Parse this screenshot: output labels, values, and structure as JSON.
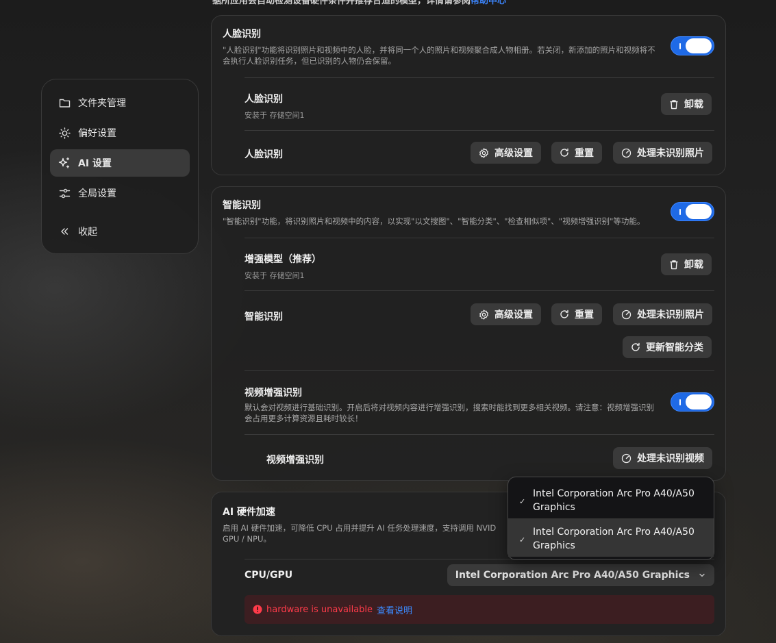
{
  "top_fragment": {
    "text": "据所应用会自动检测设备硬件条件并推荐合适的模型，详情请参阅",
    "link": "帮助中心"
  },
  "sidebar": {
    "items": [
      {
        "label": "文件夹管理",
        "icon": "folder-icon"
      },
      {
        "label": "偏好设置",
        "icon": "sun-icon"
      },
      {
        "label": "AI 设置",
        "icon": "sparkle-icon",
        "active": true
      },
      {
        "label": "全局设置",
        "icon": "sliders-icon"
      }
    ],
    "collapse_label": "收起"
  },
  "face": {
    "title": "人脸识别",
    "desc": "\"人脸识别\"功能将识别照片和视频中的人脸，并将同一个人的照片和视频聚合成人物相册。若关闭，新添加的照片和视频将不会执行人脸识别任务，但已识别的人物仍会保留。",
    "enabled": true,
    "model_title": "人脸识别",
    "model_sub": "安装于 存储空间1",
    "uninstall": "卸载",
    "action_title": "人脸识别",
    "advanced": "高级设置",
    "reset": "重置",
    "process": "处理未识别照片"
  },
  "smart": {
    "title": "智能识别",
    "desc": "\"智能识别\"功能，将识别照片和视频中的内容，以实现\"以文搜图\"、\"智能分类\"、\"检查相似项\"、\"视频增强识别\"等功能。",
    "enabled": true,
    "model_title": "增强模型（推荐）",
    "model_sub": "安装于 存储空间1",
    "uninstall": "卸载",
    "action_title": "智能识别",
    "advanced": "高级设置",
    "reset": "重置",
    "process": "处理未识别照片",
    "update_class": "更新智能分类",
    "video_title": "视频增强识别",
    "video_desc": "默认会对视频进行基础识别。开启后将对视频内容进行增强识别，搜索时能找到更多相关视频。请注意：视频增强识别会占用更多计算资源且耗时较长！",
    "video_enabled": true,
    "video_action_title": "视频增强识别",
    "video_process": "处理未识别视频"
  },
  "hw": {
    "title": "AI 硬件加速",
    "desc_line1": "启用 AI 硬件加速，可降低 CPU 占用并提升 AI 任务处理速度，支持调用 NVID",
    "desc_line2": "GPU / NPU。",
    "device_label": "CPU/GPU",
    "selected": "Intel Corporation Arc Pro A40/A50 Graphics",
    "error": "hardware is unavailable",
    "help": "查看说明"
  },
  "dropdown": {
    "options": [
      {
        "line1": "Intel Corporation Arc Pro A40/A50",
        "line2": "Graphics"
      },
      {
        "line1": "Intel Corporation Arc Pro A40/A50",
        "line2": "Graphics"
      }
    ]
  },
  "colors": {
    "accent": "#1f6ae6",
    "error": "#ff3b4a",
    "link": "#3b8bff"
  }
}
